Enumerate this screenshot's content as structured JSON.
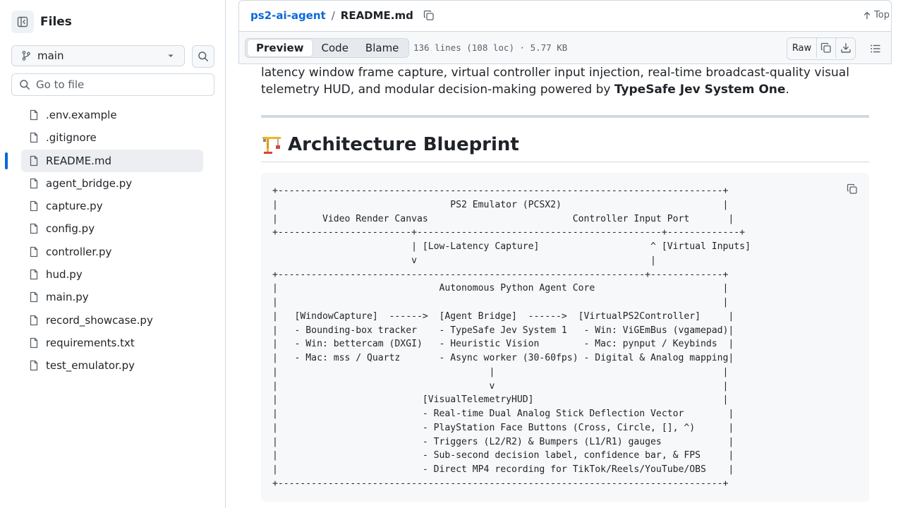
{
  "sidebar": {
    "title": "Files",
    "branch": "main",
    "search_placeholder": "Go to file",
    "files": [
      {
        "name": ".env.example",
        "active": false
      },
      {
        "name": ".gitignore",
        "active": false
      },
      {
        "name": "README.md",
        "active": true
      },
      {
        "name": "agent_bridge.py",
        "active": false
      },
      {
        "name": "capture.py",
        "active": false
      },
      {
        "name": "config.py",
        "active": false
      },
      {
        "name": "controller.py",
        "active": false
      },
      {
        "name": "hud.py",
        "active": false
      },
      {
        "name": "main.py",
        "active": false
      },
      {
        "name": "record_showcase.py",
        "active": false
      },
      {
        "name": "requirements.txt",
        "active": false
      },
      {
        "name": "test_emulator.py",
        "active": false
      }
    ]
  },
  "header": {
    "repo": "ps2-ai-agent",
    "separator": "/",
    "file": "README.md",
    "top_label": "Top"
  },
  "toolbar": {
    "tabs": [
      "Preview",
      "Code",
      "Blame"
    ],
    "active_tab": "Preview",
    "file_meta": "136 lines (108 loc) · 5.77 KB",
    "raw_label": "Raw"
  },
  "readme": {
    "intro_line1": "latency window frame capture, virtual controller input injection, real-time broadcast-quality visual",
    "intro_line2_prefix": "telemetry HUD, and modular decision-making powered by ",
    "intro_line2_bold": "TypeSafe Jev System One",
    "intro_line2_suffix": ".",
    "heading_emoji": "🏗️",
    "heading": "Architecture Blueprint",
    "code_lines": [
      "+--------------------------------------------------------------------------------+",
      "|                               PS2 Emulator (PCSX2)                             |",
      "|        Video Render Canvas                          Controller Input Port       |",
      "+------------------------+--------------------------------------------+-------------+",
      "                         | [Low-Latency Capture]                    ^ [Virtual Inputs]",
      "                         v                                          |",
      "+------------------------------------------------------------------+-------------+",
      "|                             Autonomous Python Agent Core                       |",
      "|                                                                                |",
      "|   [WindowCapture]  ------>  [Agent Bridge]  ------>  [VirtualPS2Controller]     |",
      "|   - Bounding-box tracker    - TypeSafe Jev System 1   - Win: ViGEmBus (vgamepad)|",
      "|   - Win: bettercam (DXGI)   - Heuristic Vision        - Mac: pynput / Keybinds  |",
      "|   - Mac: mss / Quartz       - Async worker (30-60fps) - Digital & Analog mapping|",
      "|                                      |                                         |",
      "|                                      v                                         |",
      "|                          [VisualTelemetryHUD]                                  |",
      "|                          - Real-time Dual Analog Stick Deflection Vector        |",
      "|                          - PlayStation Face Buttons (Cross, Circle, [], ^)      |",
      "|                          - Triggers (L2/R2) & Bumpers (L1/R1) gauges            |",
      "|                          - Sub-second decision label, confidence bar, & FPS     |",
      "|                          - Direct MP4 recording for TikTok/Reels/YouTube/OBS    |",
      "+--------------------------------------------------------------------------------+"
    ]
  },
  "icons": {
    "sidebar_toggle": "sidebar-collapse-icon",
    "branch": "git-branch-icon",
    "search": "search-icon",
    "file": "file-icon",
    "copy": "copy-icon",
    "top": "arrow-up-icon",
    "download": "download-icon",
    "outline": "list-unordered-icon"
  },
  "colors": {
    "accent": "#0969da",
    "text": "#1f2328",
    "muted": "#59636e",
    "border": "#d1d9e0",
    "canvas_subtle": "#f6f8fa"
  }
}
